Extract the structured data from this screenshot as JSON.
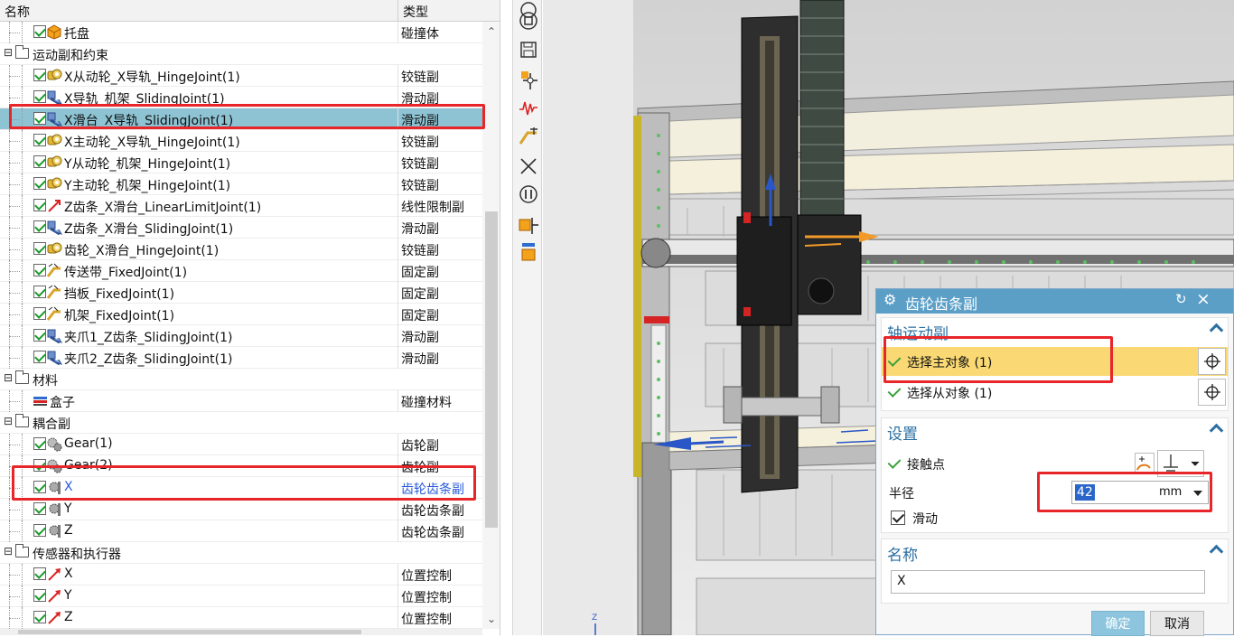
{
  "navigator": {
    "col_name": "名称",
    "col_type": "类型",
    "rows": [
      {
        "kind": "item",
        "name": "托盘",
        "type": "碰撞体",
        "icon": "cube-orange-icon"
      },
      {
        "kind": "group",
        "name": "运动副和约束"
      },
      {
        "kind": "item",
        "name": "X从动轮_X导轨_HingeJoint(1)",
        "type": "铰链副",
        "icon": "hinge-joint-icon"
      },
      {
        "kind": "item",
        "name": "X导轨_机架_SlidingJoint(1)",
        "type": "滑动副",
        "icon": "sliding-joint-icon"
      },
      {
        "kind": "item",
        "name": "X滑台_X导轨_SlidingJoint(1)",
        "type": "滑动副",
        "icon": "sliding-joint-icon",
        "selected": true
      },
      {
        "kind": "item",
        "name": "X主动轮_X导轨_HingeJoint(1)",
        "type": "铰链副",
        "icon": "hinge-joint-icon"
      },
      {
        "kind": "item",
        "name": "Y从动轮_机架_HingeJoint(1)",
        "type": "铰链副",
        "icon": "hinge-joint-icon"
      },
      {
        "kind": "item",
        "name": "Y主动轮_机架_HingeJoint(1)",
        "type": "铰链副",
        "icon": "hinge-joint-icon"
      },
      {
        "kind": "item",
        "name": "Z齿条_X滑台_LinearLimitJoint(1)",
        "type": "线性限制副",
        "icon": "limit-joint-icon"
      },
      {
        "kind": "item",
        "name": "Z齿条_X滑台_SlidingJoint(1)",
        "type": "滑动副",
        "icon": "sliding-joint-icon"
      },
      {
        "kind": "item",
        "name": "齿轮_X滑台_HingeJoint(1)",
        "type": "铰链副",
        "icon": "hinge-joint-icon"
      },
      {
        "kind": "item",
        "name": "传送带_FixedJoint(1)",
        "type": "固定副",
        "icon": "fixed-joint-icon"
      },
      {
        "kind": "item",
        "name": "挡板_FixedJoint(1)",
        "type": "固定副",
        "icon": "fixed-joint-icon"
      },
      {
        "kind": "item",
        "name": "机架_FixedJoint(1)",
        "type": "固定副",
        "icon": "fixed-joint-icon"
      },
      {
        "kind": "item",
        "name": "夹爪1_Z齿条_SlidingJoint(1)",
        "type": "滑动副",
        "icon": "sliding-joint-icon"
      },
      {
        "kind": "item",
        "name": "夹爪2_Z齿条_SlidingJoint(1)",
        "type": "滑动副",
        "icon": "sliding-joint-icon"
      },
      {
        "kind": "group",
        "name": "材料"
      },
      {
        "kind": "item",
        "name": "盒子",
        "type": "碰撞材料",
        "icon": "material-icon",
        "nocheck": true
      },
      {
        "kind": "group",
        "name": "耦合副"
      },
      {
        "kind": "item",
        "name": "Gear(1)",
        "type": "齿轮副",
        "icon": "gear-coupler-icon"
      },
      {
        "kind": "item",
        "name": "Gear(2)",
        "type": "齿轮副",
        "icon": "gear-coupler-icon"
      },
      {
        "kind": "item",
        "name": "X",
        "type": "齿轮齿条副",
        "icon": "rack-pinion-icon",
        "active": true
      },
      {
        "kind": "item",
        "name": "Y",
        "type": "齿轮齿条副",
        "icon": "rack-pinion-icon"
      },
      {
        "kind": "item",
        "name": "Z",
        "type": "齿轮齿条副",
        "icon": "rack-pinion-icon"
      },
      {
        "kind": "group",
        "name": "传感器和执行器"
      },
      {
        "kind": "item",
        "name": "X",
        "type": "位置控制",
        "icon": "position-control-icon"
      },
      {
        "kind": "item",
        "name": "Y",
        "type": "位置控制",
        "icon": "position-control-icon"
      },
      {
        "kind": "item",
        "name": "Z",
        "type": "位置控制",
        "icon": "position-control-icon"
      }
    ]
  },
  "toolbar": {
    "icons": [
      "circle-icon",
      "stop-icon",
      "save-icon",
      "move-object-icon",
      "signal-icon",
      "joint-tool-icon",
      "close-x-icon",
      "pause-icon",
      "assembly-icon",
      "component-icon"
    ]
  },
  "dialog": {
    "title": "齿轮齿条副",
    "section_axis": "轴运动副",
    "select_master": "选择主对象 (1)",
    "select_slave": "选择从对象 (1)",
    "section_settings": "设置",
    "contact_point": "接触点",
    "radius_label": "半径",
    "radius_value": "42",
    "radius_unit": "mm",
    "slide_label": "滑动",
    "section_name": "名称",
    "name_value": "X",
    "ok": "确定",
    "cancel": "取消"
  },
  "colors": {
    "accent": "#5b9fc7",
    "highlight": "#fad974",
    "selected_row": "#8dc3d3",
    "annotation": "#e8262a"
  }
}
